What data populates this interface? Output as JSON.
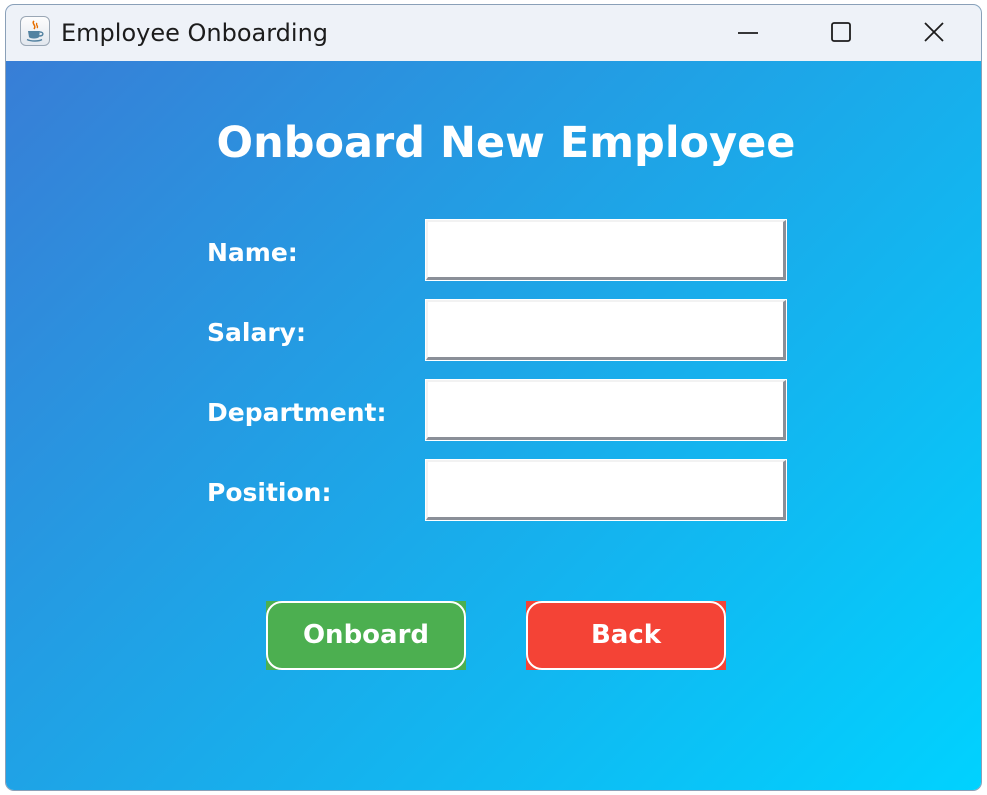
{
  "window": {
    "title": "Employee Onboarding",
    "icon": "java-cup-icon",
    "controls": {
      "minimize": "minimize-icon",
      "maximize": "maximize-icon",
      "close": "close-icon"
    }
  },
  "form": {
    "heading": "Onboard New Employee",
    "fields": [
      {
        "label": "Name:",
        "value": "",
        "placeholder": ""
      },
      {
        "label": "Salary:",
        "value": "",
        "placeholder": ""
      },
      {
        "label": "Department:",
        "value": "",
        "placeholder": ""
      },
      {
        "label": "Position:",
        "value": "",
        "placeholder": ""
      }
    ]
  },
  "actions": {
    "onboard_label": "Onboard",
    "back_label": "Back"
  },
  "colors": {
    "background_gradient_start": "#3a7bd5",
    "background_gradient_end": "#00d2ff",
    "onboard_button": "#4caf50",
    "back_button": "#f44336",
    "text": "#ffffff"
  }
}
